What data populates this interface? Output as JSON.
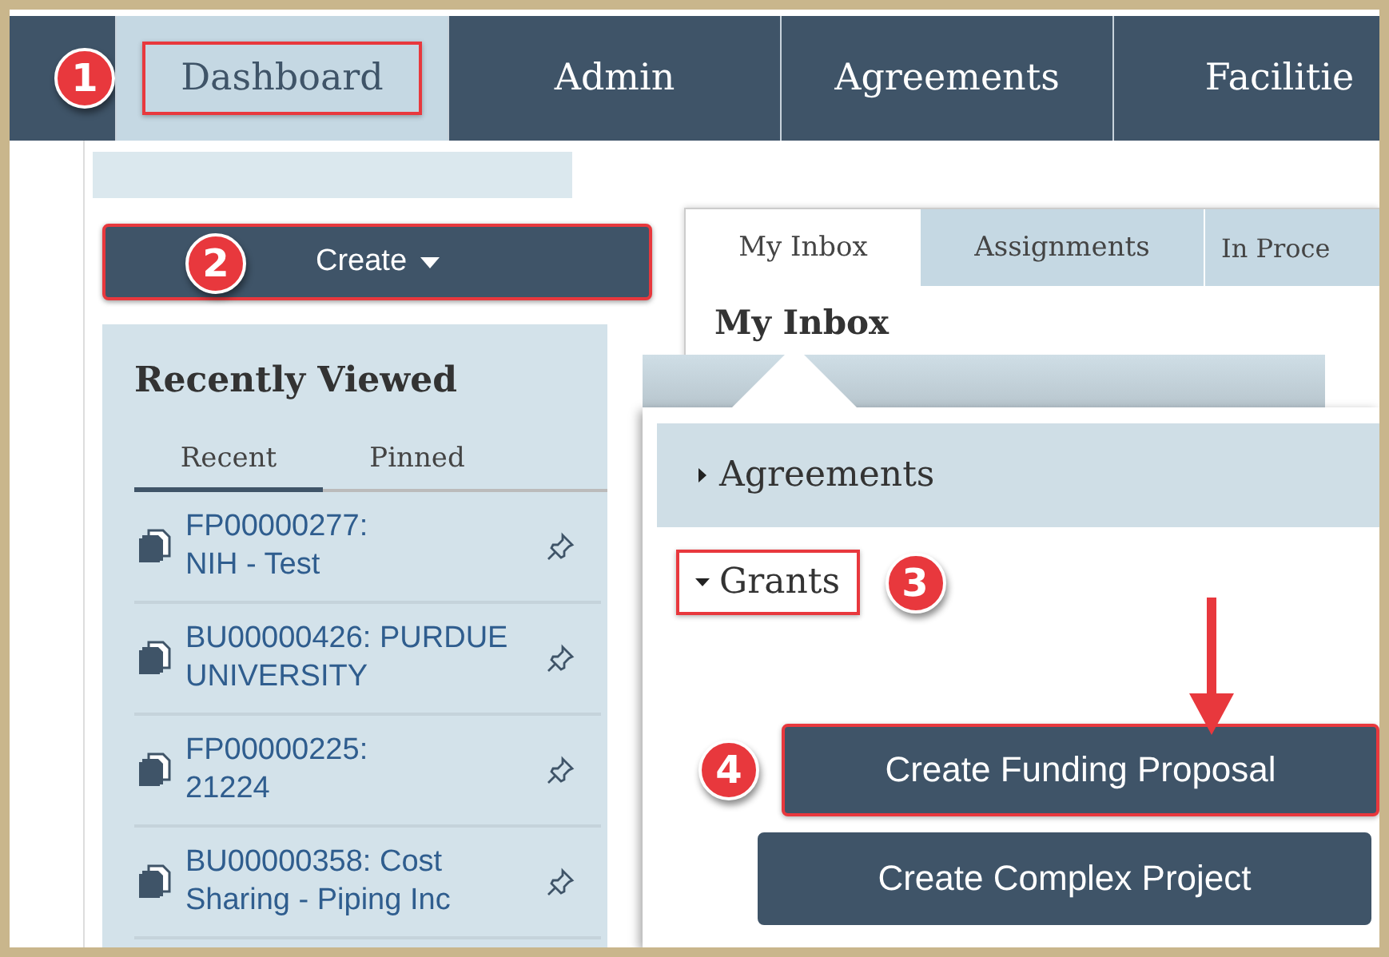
{
  "nav": {
    "step": "1",
    "tabs": [
      {
        "label": "Dashboard",
        "selected": true,
        "highlighted": true
      },
      {
        "label": "Admin",
        "selected": false,
        "highlighted": false
      },
      {
        "label": "Agreements",
        "selected": false,
        "highlighted": false
      },
      {
        "label": "Facilitie",
        "selected": false,
        "highlighted": false
      }
    ]
  },
  "create_button": {
    "label": "Create",
    "step": "2",
    "highlighted": true
  },
  "recently_viewed": {
    "title": "Recently Viewed",
    "tabs": [
      {
        "label": "Recent",
        "selected": true
      },
      {
        "label": "Pinned",
        "selected": false
      }
    ],
    "items": [
      {
        "lines": [
          "FP00000277:",
          "NIH - Test"
        ]
      },
      {
        "lines": [
          "BU00000426: PURDUE",
          "UNIVERSITY"
        ]
      },
      {
        "lines": [
          "FP00000225:",
          "21224"
        ]
      },
      {
        "lines": [
          "BU00000358: Cost",
          "Sharing - Piping Inc"
        ]
      }
    ]
  },
  "inbox": {
    "tabs": [
      {
        "label": "My Inbox",
        "selected": true
      },
      {
        "label": "Assignments",
        "selected": false
      },
      {
        "label": "In Proce",
        "selected": false
      }
    ],
    "heading": "My Inbox"
  },
  "create_menu": {
    "sections": [
      {
        "label": "Agreements",
        "expanded": false,
        "highlighted": false
      },
      {
        "label": "Grants",
        "expanded": true,
        "highlighted": true,
        "step": "3"
      }
    ],
    "buttons": [
      {
        "label": "Create Funding Proposal",
        "highlighted": true,
        "step": "4"
      },
      {
        "label": "Create Complex Project",
        "highlighted": false
      }
    ]
  }
}
